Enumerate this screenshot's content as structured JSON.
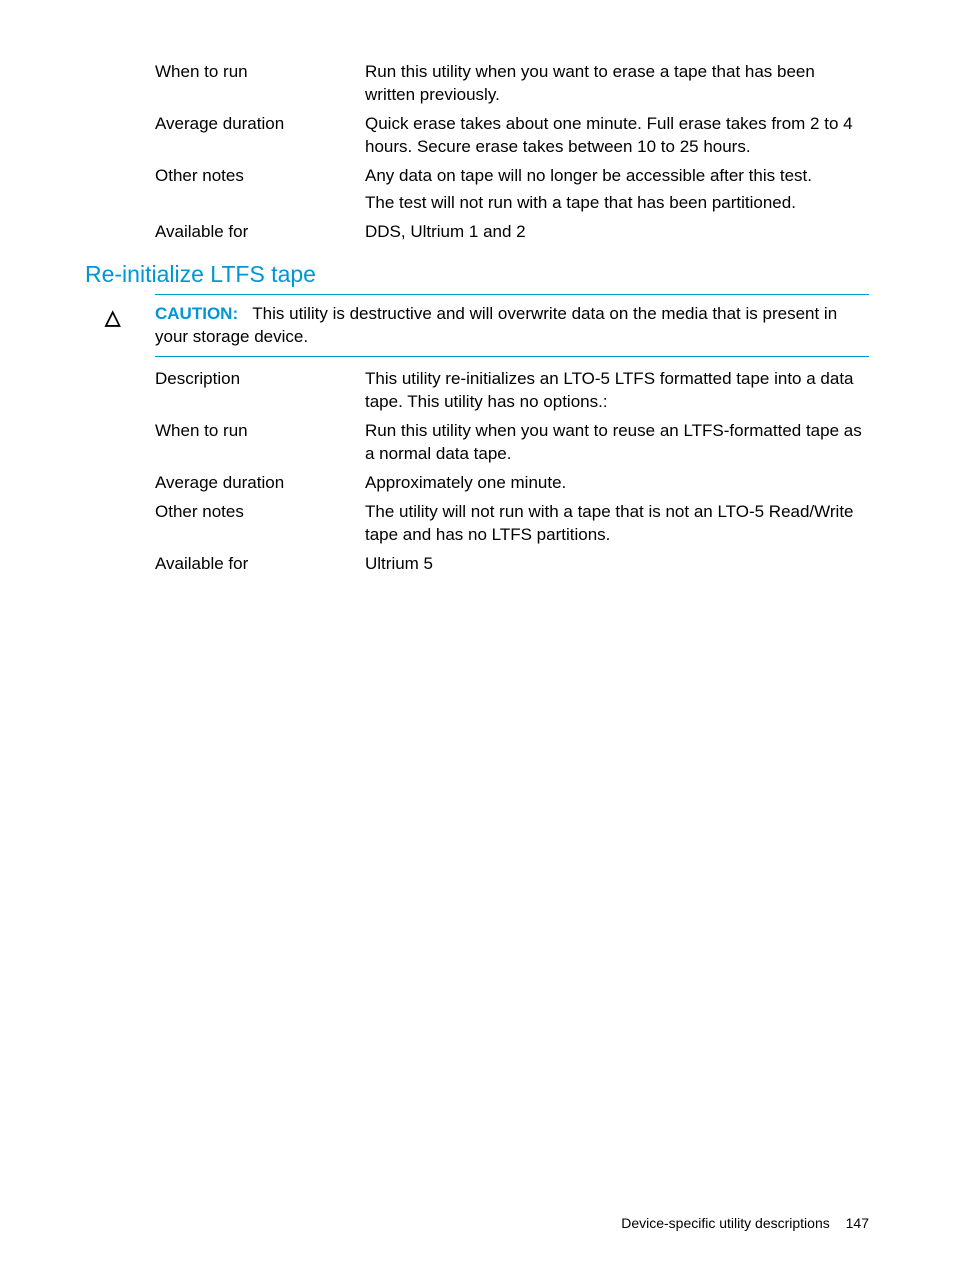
{
  "table1": {
    "rows": [
      {
        "label": "When to run",
        "values": [
          "Run this utility when you want to erase a tape that has been written previously."
        ]
      },
      {
        "label": "Average duration",
        "values": [
          "Quick erase takes about one minute. Full erase takes from 2 to 4 hours. Secure erase takes between 10 to 25 hours."
        ]
      },
      {
        "label": "Other notes",
        "values": [
          "Any data on tape will no longer be accessible after this test.",
          "The test will not run with a tape that has been partitioned."
        ]
      },
      {
        "label": "Available for",
        "values": [
          "DDS, Ultrium 1 and 2"
        ]
      }
    ]
  },
  "section2": {
    "heading": "Re-initialize LTFS tape",
    "caution_label": "CAUTION:",
    "caution_text": "This utility is destructive and will overwrite data on the media that is present in your storage device."
  },
  "table2": {
    "rows": [
      {
        "label": "Description",
        "values": [
          "This utility re-initializes an LTO-5 LTFS formatted tape into a data tape. This utility has no options.:"
        ]
      },
      {
        "label": "When to run",
        "values": [
          "Run this utility when you want to reuse an LTFS-formatted tape as a normal data tape."
        ]
      },
      {
        "label": "Average duration",
        "values": [
          "Approximately one minute."
        ]
      },
      {
        "label": "Other notes",
        "values": [
          "The utility will not run with a tape that is not an LTO-5 Read/Write tape and has no LTFS partitions."
        ]
      },
      {
        "label": "Available for",
        "values": [
          "Ultrium 5"
        ]
      }
    ]
  },
  "footer": {
    "text": "Device-specific utility descriptions",
    "page": "147"
  }
}
